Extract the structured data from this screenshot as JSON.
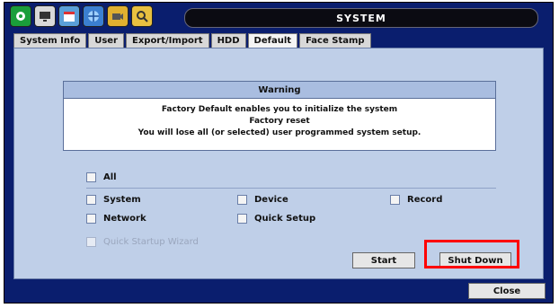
{
  "window": {
    "title": "SYSTEM"
  },
  "toolbar_icons": [
    {
      "name": "system-setup-icon",
      "color": "#1a9e3a"
    },
    {
      "name": "display-icon",
      "color": "#d9d9d9"
    },
    {
      "name": "schedule-icon",
      "color": "#5aa0d8"
    },
    {
      "name": "network-icon",
      "color": "#3b7fd1"
    },
    {
      "name": "record-icon",
      "color": "#e0b030"
    },
    {
      "name": "search-icon",
      "color": "#e8c040"
    }
  ],
  "tabs": [
    {
      "label": "System Info",
      "active": false
    },
    {
      "label": "User",
      "active": false
    },
    {
      "label": "Export/Import",
      "active": false
    },
    {
      "label": "HDD",
      "active": false
    },
    {
      "label": "Default",
      "active": true
    },
    {
      "label": "Face Stamp",
      "active": false
    }
  ],
  "warning": {
    "title": "Warning",
    "lines": [
      "Factory Default enables you to initialize the system",
      "Factory reset",
      "You will lose all (or selected) user programmed system setup."
    ]
  },
  "options": {
    "all": "All",
    "system": "System",
    "device": "Device",
    "record": "Record",
    "network": "Network",
    "quick_setup": "Quick Setup",
    "quick_startup_wizard": "Quick Startup Wizard"
  },
  "buttons": {
    "start": "Start",
    "shutdown": "Shut Down",
    "close": "Close"
  },
  "colors": {
    "window": "#0a1e6e",
    "panel": "#bfcfe8",
    "highlight": "#ff0000"
  }
}
